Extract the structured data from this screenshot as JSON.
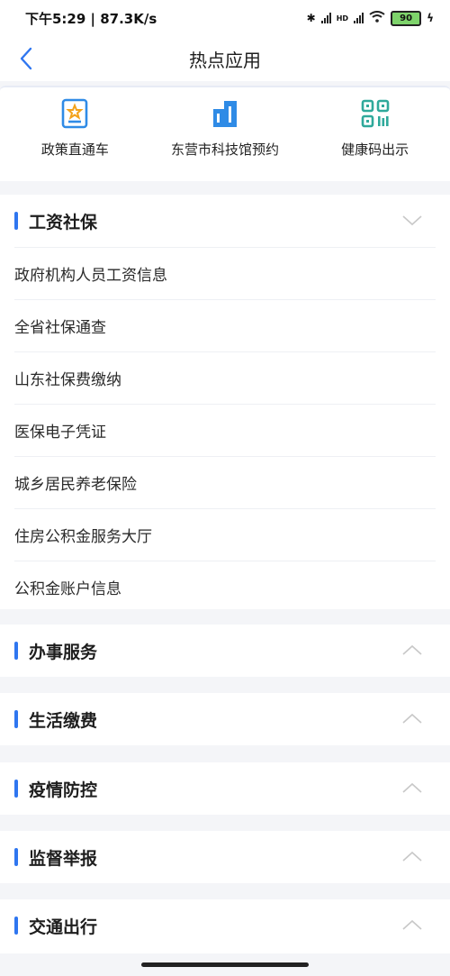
{
  "status_bar": {
    "time_speed": "下午5:29 | 87.3K/s",
    "hd_label": "HD",
    "battery": "90"
  },
  "nav": {
    "title": "热点应用"
  },
  "apps": [
    {
      "label": "政策直通车",
      "icon": "policy-badge-icon"
    },
    {
      "label": "东营市科技馆预约",
      "icon": "building-icon"
    },
    {
      "label": "健康码出示",
      "icon": "qr-code-icon"
    }
  ],
  "sections": [
    {
      "title": "工资社保",
      "expanded": true,
      "items": [
        "政府机构人员工资信息",
        "全省社保通查",
        "山东社保费缴纳",
        "医保电子凭证",
        "城乡居民养老保险",
        "住房公积金服务大厅",
        "公积金账户信息"
      ]
    },
    {
      "title": "办事服务",
      "expanded": false
    },
    {
      "title": "生活缴费",
      "expanded": false
    },
    {
      "title": "疫情防控",
      "expanded": false
    },
    {
      "title": "监督举报",
      "expanded": false
    },
    {
      "title": "交通出行",
      "expanded": false
    }
  ],
  "colors": {
    "accent": "#2f76f0",
    "icon_blue": "#2f8be6",
    "icon_teal": "#2fa99b"
  }
}
